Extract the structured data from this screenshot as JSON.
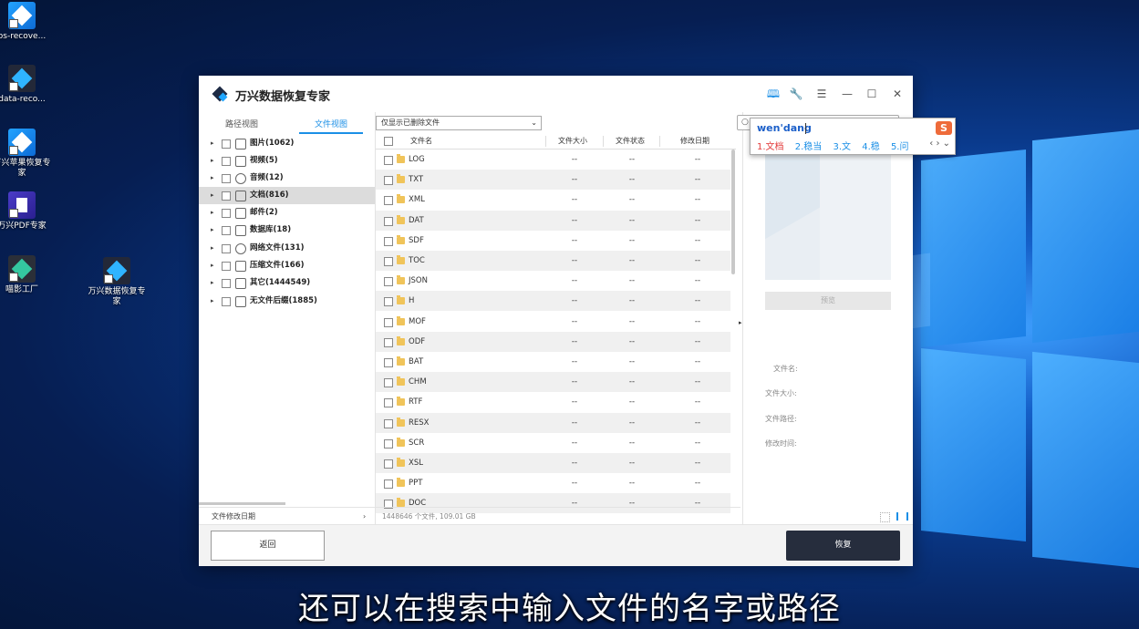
{
  "desktop": {
    "icons": [
      {
        "label": "os-recove...",
        "style": "wx"
      },
      {
        "label": "data-reco...",
        "style": "dark"
      },
      {
        "label": "万兴苹果恢复专家",
        "style": "wx"
      },
      {
        "label": "万兴PDF专家",
        "style": "pdf"
      },
      {
        "label": "喵影工厂",
        "style": "film"
      },
      {
        "label": "万兴数据恢复专家",
        "style": "dark"
      }
    ]
  },
  "app": {
    "title": "万兴数据恢复专家",
    "accent": "#1b8fe6",
    "titlebar_icons": [
      "book-icon",
      "wrench-icon",
      "menu-icon",
      "minimize-icon",
      "maximize-icon",
      "close-icon"
    ],
    "glyphs": {
      "book": "🕮",
      "wrench": "🔧",
      "menu": "☰",
      "minimize": "—",
      "maximize": "☐",
      "close": "✕"
    }
  },
  "left_panel": {
    "tabs": [
      "路径视图",
      "文件视图"
    ],
    "active_tab": "文件视图",
    "tree": [
      {
        "label": "图片(1062)",
        "icon": "image-icon"
      },
      {
        "label": "视频(5)",
        "icon": "video-icon"
      },
      {
        "label": "音频(12)",
        "icon": "audio-icon"
      },
      {
        "label": "文档(816)",
        "icon": "document-icon",
        "selected": true
      },
      {
        "label": "邮件(2)",
        "icon": "email-icon"
      },
      {
        "label": "数据库(18)",
        "icon": "database-icon"
      },
      {
        "label": "网络文件(131)",
        "icon": "globe-icon"
      },
      {
        "label": "压缩文件(166)",
        "icon": "archive-icon"
      },
      {
        "label": "其它(1444549)",
        "icon": "other-icon"
      },
      {
        "label": "无文件后缀(1885)",
        "icon": "folder-icon"
      }
    ],
    "footer_label": "文件修改日期",
    "footer_arrow": "›"
  },
  "middle_panel": {
    "filter": {
      "value": "仅显示已删除文件",
      "caret": "⌄"
    },
    "columns": [
      "文件名",
      "文件大小",
      "文件状态",
      "修改日期"
    ],
    "rows": [
      {
        "name": "LOG",
        "size": "--",
        "status": "--",
        "date": "--"
      },
      {
        "name": "TXT",
        "size": "--",
        "status": "--",
        "date": "--"
      },
      {
        "name": "XML",
        "size": "--",
        "status": "--",
        "date": "--"
      },
      {
        "name": "DAT",
        "size": "--",
        "status": "--",
        "date": "--"
      },
      {
        "name": "SDF",
        "size": "--",
        "status": "--",
        "date": "--"
      },
      {
        "name": "TOC",
        "size": "--",
        "status": "--",
        "date": "--"
      },
      {
        "name": "JSON",
        "size": "--",
        "status": "--",
        "date": "--"
      },
      {
        "name": "H",
        "size": "--",
        "status": "--",
        "date": "--"
      },
      {
        "name": "MOF",
        "size": "--",
        "status": "--",
        "date": "--"
      },
      {
        "name": "ODF",
        "size": "--",
        "status": "--",
        "date": "--"
      },
      {
        "name": "BAT",
        "size": "--",
        "status": "--",
        "date": "--"
      },
      {
        "name": "CHM",
        "size": "--",
        "status": "--",
        "date": "--"
      },
      {
        "name": "RTF",
        "size": "--",
        "status": "--",
        "date": "--"
      },
      {
        "name": "RESX",
        "size": "--",
        "status": "--",
        "date": "--"
      },
      {
        "name": "SCR",
        "size": "--",
        "status": "--",
        "date": "--"
      },
      {
        "name": "XSL",
        "size": "--",
        "status": "--",
        "date": "--"
      },
      {
        "name": "PPT",
        "size": "--",
        "status": "--",
        "date": "--"
      },
      {
        "name": "DOC",
        "size": "--",
        "status": "--",
        "date": "--"
      }
    ],
    "footer_summary": "1448646 个文件, 109.01 GB",
    "collapse_arrow": "▸"
  },
  "right_panel": {
    "search_icon": "○",
    "preview_button": "预览",
    "meta_labels": [
      "文件名:",
      "文件大小:",
      "文件路径:",
      "修改时间:"
    ]
  },
  "buttons": {
    "back": "返回",
    "recover": "恢复"
  },
  "ime": {
    "composition": "wen'dang",
    "logo": "S",
    "candidates": [
      "1.文档",
      "2.稳当",
      "3.文",
      "4.稳",
      "5.问"
    ],
    "nav": "‹ › ⌄"
  },
  "subtitle": "还可以在搜索中输入文件的名字或路径"
}
